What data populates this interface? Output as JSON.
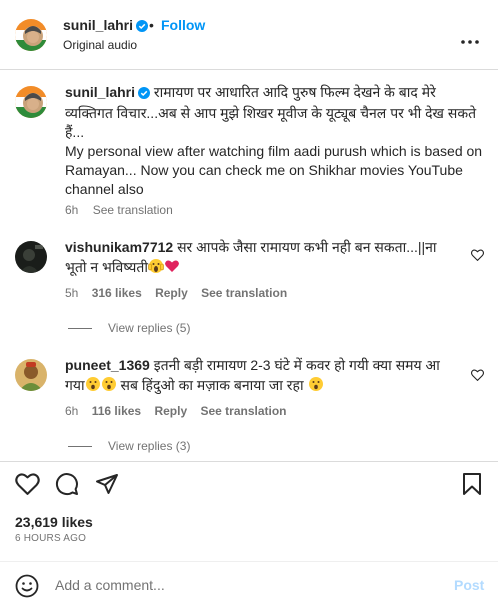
{
  "post": {
    "author": "sunil_lahri",
    "separator": "•",
    "follow_label": "Follow",
    "audio_label": "Original audio"
  },
  "caption": {
    "author": "sunil_lahri",
    "text_hindi": "रामायण पर आधारित आदि पुरुष फिल्म देखने के बाद मेरे व्यक्तिगत विचार...अब से आप मुझे शिखर मूवीज के यूट्यूब चैनल पर भी देख सकते हैं...",
    "text_english": "My personal view after watching film aadi purush which is based on Ramayan... Now you can check me on Shikhar movies YouTube channel also",
    "time": "6h",
    "translate_label": "See translation"
  },
  "comments": [
    {
      "author": "vishunikam7712",
      "text": "सर आपके जैसा रामायण कभी नही बन सकता...||ना भूतो न भविष्यती",
      "emojis": [
        "scream-emoji",
        "red-heart-emoji"
      ],
      "time": "5h",
      "likes": "316 likes",
      "reply_label": "Reply",
      "translate_label": "See translation",
      "view_replies": "View replies (5)"
    },
    {
      "author": "puneet_1369",
      "text_part1": "इतनी बड़ी रामायण 2-3 घंटे में कवर हो गयी क्या समय आ गया",
      "text_part2": "सब हिंदुओ का मज़ाक बनाया जा रहा",
      "emojis": [
        "astonished-emoji",
        "astonished-emoji",
        "astonished-emoji"
      ],
      "time": "6h",
      "likes": "116 likes",
      "reply_label": "Reply",
      "translate_label": "See translation",
      "view_replies": "View replies (3)"
    }
  ],
  "footer": {
    "likes": "23,619 likes",
    "time": "6 HOURS AGO",
    "comment_placeholder": "Add a comment...",
    "post_label": "Post",
    "icons": [
      "heart-icon",
      "comment-icon",
      "share-icon",
      "bookmark-icon",
      "emoji-icon"
    ]
  },
  "colors": {
    "accent": "#0095f6",
    "verified": "#0095f6",
    "muted": "#737373",
    "post_disabled": "#b3dbff"
  }
}
